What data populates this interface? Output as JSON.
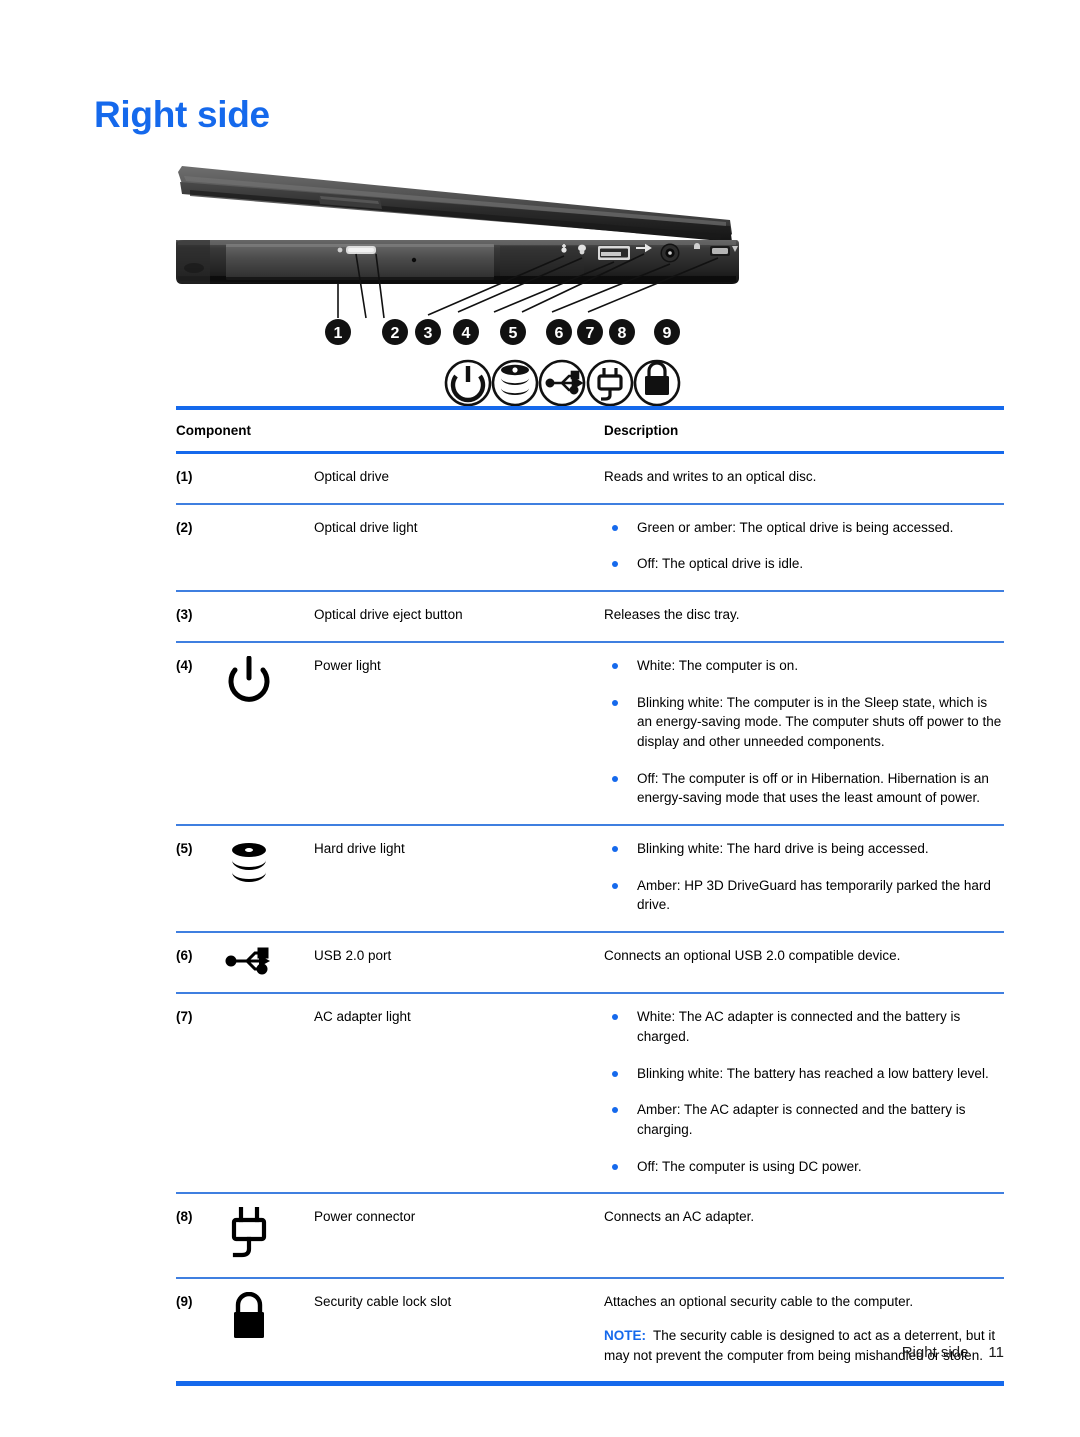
{
  "heading": "Right side",
  "colors": {
    "accent": "#1569ec",
    "rule": "#3f7fe0",
    "text": "#000000"
  },
  "illustration": {
    "alt": "hp-laptop-right-side-profile",
    "callouts": [
      "1",
      "2",
      "3",
      "4",
      "5",
      "6",
      "7",
      "8",
      "9"
    ],
    "legend_icons": [
      "power-icon",
      "hard-drive-icon",
      "usb-icon",
      "power-connector-icon",
      "security-lock-icon"
    ]
  },
  "table": {
    "headers": {
      "component": "Component",
      "description": "Description"
    },
    "rows": [
      {
        "num": "(1)",
        "icon": "",
        "name": "Optical drive",
        "desc_type": "plain",
        "desc": "Reads and writes to an optical disc."
      },
      {
        "num": "(2)",
        "icon": "",
        "name": "Optical drive light",
        "desc_type": "bullets",
        "bullets": [
          "Green or amber: The optical drive is being accessed.",
          "Off: The optical drive is idle."
        ]
      },
      {
        "num": "(3)",
        "icon": "",
        "name": "Optical drive eject button",
        "desc_type": "plain",
        "desc": "Releases the disc tray."
      },
      {
        "num": "(4)",
        "icon": "power-icon",
        "name": "Power light",
        "desc_type": "bullets",
        "bullets": [
          "White: The computer is on.",
          "Blinking white: The computer is in the Sleep state, which is an energy-saving mode. The computer shuts off power to the display and other unneeded components.",
          "Off: The computer is off or in Hibernation. Hibernation is an energy-saving mode that uses the least amount of power."
        ]
      },
      {
        "num": "(5)",
        "icon": "hard-drive-icon",
        "name": "Hard drive light",
        "desc_type": "bullets",
        "bullets": [
          "Blinking white: The hard drive is being accessed.",
          "Amber: HP 3D DriveGuard has temporarily parked the hard drive."
        ]
      },
      {
        "num": "(6)",
        "icon": "usb-icon",
        "name": "USB 2.0 port",
        "desc_type": "plain",
        "desc": "Connects an optional USB 2.0 compatible device."
      },
      {
        "num": "(7)",
        "icon": "",
        "name": "AC adapter light",
        "desc_type": "bullets",
        "bullets": [
          "White: The AC adapter is connected and the battery is charged.",
          "Blinking white: The battery has reached a low battery level.",
          "Amber: The AC adapter is connected and the battery is charging.",
          "Off: The computer is using DC power."
        ]
      },
      {
        "num": "(8)",
        "icon": "power-connector-icon",
        "name": "Power connector",
        "desc_type": "plain",
        "desc": "Connects an AC adapter."
      },
      {
        "num": "(9)",
        "icon": "security-lock-icon",
        "name": "Security cable lock slot",
        "desc_type": "plain_with_note",
        "desc": "Attaches an optional security cable to the computer.",
        "note_label": "NOTE:",
        "note_text": "The security cable is designed to act as a deterrent, but it may not prevent the computer from being mishandled or stolen."
      }
    ]
  },
  "footer": {
    "label": "Right side",
    "page_number": "11"
  }
}
